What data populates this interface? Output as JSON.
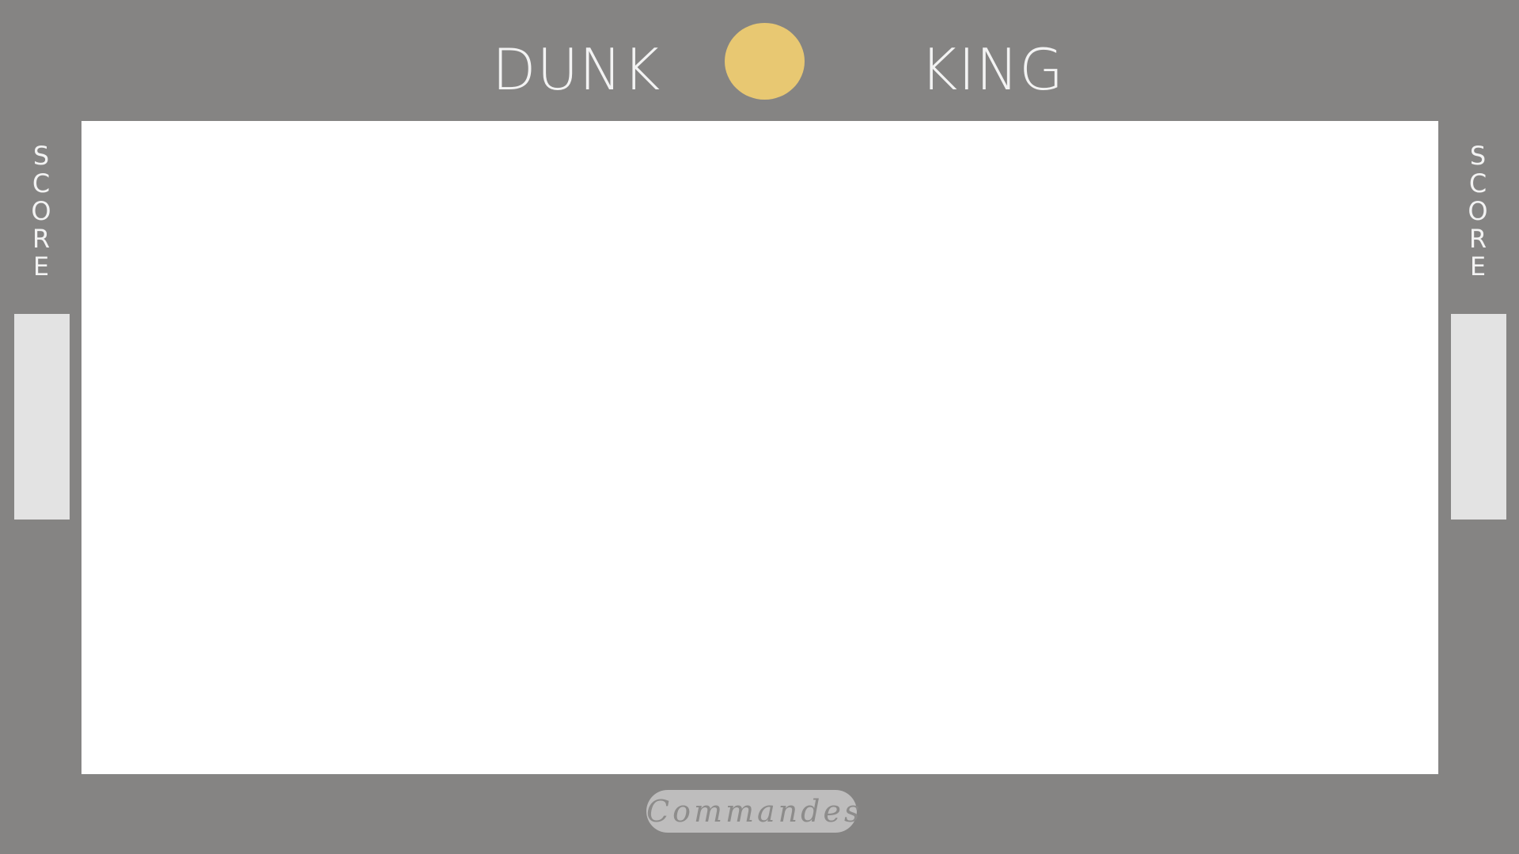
{
  "header": {
    "title_left": "DUNK",
    "title_right": "KING"
  },
  "ball_color": "#e8c872",
  "score_left": {
    "letters": [
      "S",
      "C",
      "O",
      "R",
      "E"
    ]
  },
  "score_right": {
    "letters": [
      "S",
      "C",
      "O",
      "R",
      "E"
    ]
  },
  "commands": {
    "label": "Commandes"
  },
  "colors": {
    "background": "#858483",
    "court": "#ffffff",
    "score_bar": "#e3e3e3",
    "button": "#bebdbd"
  }
}
